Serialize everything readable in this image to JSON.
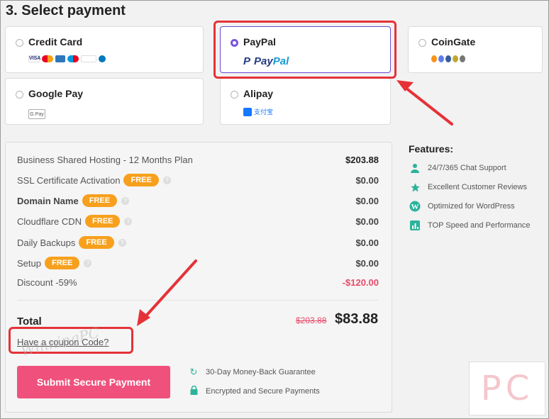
{
  "section_title": "3. Select payment",
  "payment_methods": [
    {
      "name": "Credit Card",
      "logos": [
        "visa",
        "mastercard",
        "amex",
        "maestro",
        "discover",
        "diners"
      ]
    },
    {
      "name": "PayPal",
      "logo_text_1": "Pay",
      "logo_text_2": "Pal",
      "selected": true
    },
    {
      "name": "CoinGate",
      "logos": [
        "bitcoin",
        "ethereum",
        "litecoin",
        "ripple",
        "dogecoin"
      ]
    },
    {
      "name": "Google Pay",
      "logo_text": "G Pay"
    },
    {
      "name": "Alipay",
      "logo_text": "支付宝"
    }
  ],
  "summary": {
    "lines": [
      {
        "label": "Business Shared Hosting - 12 Months Plan",
        "amount": "$203.88"
      },
      {
        "label": "SSL Certificate Activation",
        "badge": "FREE",
        "amount": "$0.00"
      },
      {
        "label": "Domain Name",
        "badge": "FREE",
        "amount": "$0.00"
      },
      {
        "label": "Cloudflare CDN",
        "badge": "FREE",
        "amount": "$0.00"
      },
      {
        "label": "Daily Backups",
        "badge": "FREE",
        "amount": "$0.00"
      },
      {
        "label": "Setup",
        "badge": "FREE",
        "amount": "$0.00"
      },
      {
        "label": "Discount -59%",
        "amount": "-$120.00"
      }
    ],
    "total_label": "Total",
    "total_old": "$203.88",
    "total_new": "$83.88",
    "coupon_text": "Have a coupon Code?"
  },
  "submit_label": "Submit Secure Payment",
  "guarantees": [
    "30-Day Money-Back Guarantee",
    "Encrypted and Secure Payments"
  ],
  "features_title": "Features:",
  "features": [
    {
      "text": "24/7/365 Chat Support",
      "icon": "user-support-icon"
    },
    {
      "text": "Excellent Customer Reviews",
      "icon": "star-icon"
    },
    {
      "text": "Optimized for WordPress",
      "icon": "wordpress-icon"
    },
    {
      "text": "TOP Speed and Performance",
      "icon": "speed-chart-icon"
    }
  ],
  "watermark_text": "WinningPC",
  "corner_logo_text": "PC",
  "colors": {
    "accent_purple": "#7b55e0",
    "submit_pink": "#f0517c",
    "free_orange": "#f7a01d",
    "annotation_red": "#e53238",
    "feature_teal": "#2bb39a"
  }
}
